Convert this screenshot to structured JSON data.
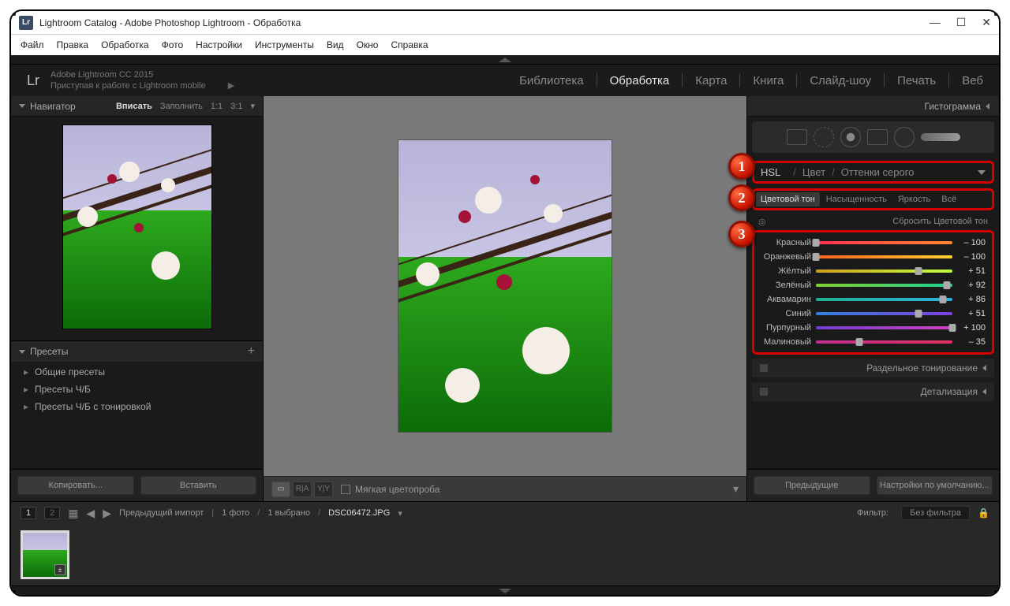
{
  "window": {
    "title": "Lightroom Catalog - Adobe Photoshop Lightroom - Обработка"
  },
  "menu": [
    "Файл",
    "Правка",
    "Обработка",
    "Фото",
    "Настройки",
    "Инструменты",
    "Вид",
    "Окно",
    "Справка"
  ],
  "header": {
    "logo": "Lr",
    "line1": "Adobe Lightroom CC 2015",
    "line2": "Приступая к работе с Lightroom mobile"
  },
  "modules": {
    "items": [
      "Библиотека",
      "Обработка",
      "Карта",
      "Книга",
      "Слайд-шоу",
      "Печать",
      "Веб"
    ],
    "active": 1
  },
  "navigator": {
    "title": "Навигатор",
    "zoom": {
      "fit": "Вписать",
      "fill": "Заполнить",
      "one": "1:1",
      "three": "3:1"
    }
  },
  "presets": {
    "title": "Пресеты",
    "items": [
      "Общие пресеты",
      "Пресеты Ч/Б",
      "Пресеты Ч/Б с тонировкой"
    ]
  },
  "left_buttons": {
    "copy": "Копировать...",
    "paste": "Вставить"
  },
  "softproof": "Мягкая цветопроба",
  "right": {
    "histogram": "Гистограмма",
    "hsl": {
      "hsl": "HSL",
      "color": "Цвет",
      "gray": "Оттенки серого"
    },
    "subtabs": {
      "hue": "Цветовой тон",
      "sat": "Насыщенность",
      "lum": "Яркость",
      "all": "Всё"
    },
    "reset": "Сбросить Цветовой тон",
    "sliders": {
      "red": {
        "label": "Красный",
        "value": "– 100"
      },
      "orange": {
        "label": "Оранжевый",
        "value": "– 100"
      },
      "yellow": {
        "label": "Жёлтый",
        "value": "+ 51"
      },
      "green": {
        "label": "Зелёный",
        "value": "+ 92"
      },
      "aqua": {
        "label": "Аквамарин",
        "value": "+ 86"
      },
      "blue": {
        "label": "Синий",
        "value": "+ 51"
      },
      "purple": {
        "label": "Пурпурный",
        "value": "+ 100"
      },
      "magenta": {
        "label": "Малиновый",
        "value": "– 35"
      }
    },
    "panels": {
      "split": "Раздельное тонирование",
      "detail": "Детализация"
    },
    "buttons": {
      "prev": "Предыдущие",
      "reset": "Настройки по умолчанию..."
    }
  },
  "filmstrip": {
    "p1": "1",
    "p2": "2",
    "prev_import": "Предыдущий импорт",
    "count": "1 фото",
    "sel": "1 выбрано",
    "file": "DSC06472.JPG",
    "filter_label": "Фильтр:",
    "filter_value": "Без фильтра"
  },
  "badges": [
    "1",
    "2",
    "3"
  ]
}
